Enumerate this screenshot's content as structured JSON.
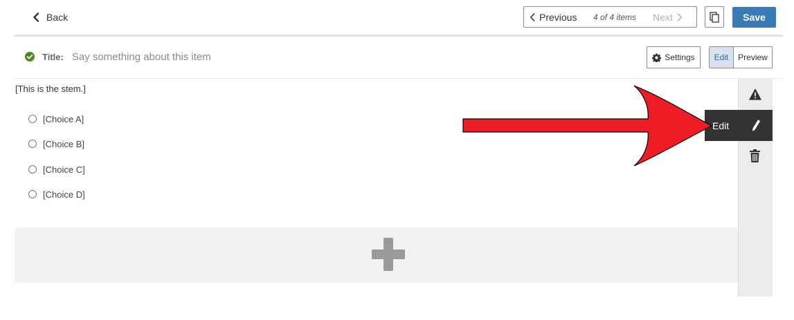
{
  "header": {
    "back_label": "Back",
    "pager": {
      "previous_label": "Previous",
      "count_label": "4 of 4 items",
      "next_label": "Next"
    },
    "save_label": "Save"
  },
  "item": {
    "title_label": "Title:",
    "title_placeholder": "Say something about this item",
    "status": "valid",
    "settings_label": "Settings",
    "mode": {
      "edit_label": "Edit",
      "preview_label": "Preview",
      "active": "Edit"
    }
  },
  "question": {
    "stem": "[This is the stem.]",
    "choices": [
      {
        "label": "[Choice A]"
      },
      {
        "label": "[Choice B]"
      },
      {
        "label": "[Choice C]"
      },
      {
        "label": "[Choice D]"
      }
    ]
  },
  "tool_rail": {
    "edit_label": "Edit",
    "icons": [
      "warning-icon",
      "pencil-icon",
      "trash-icon"
    ]
  },
  "colors": {
    "primary": "#3a7ab5",
    "success": "#4c8a1e",
    "tooltip_bg": "#333333",
    "annotation_arrow": "#ee1c25"
  }
}
